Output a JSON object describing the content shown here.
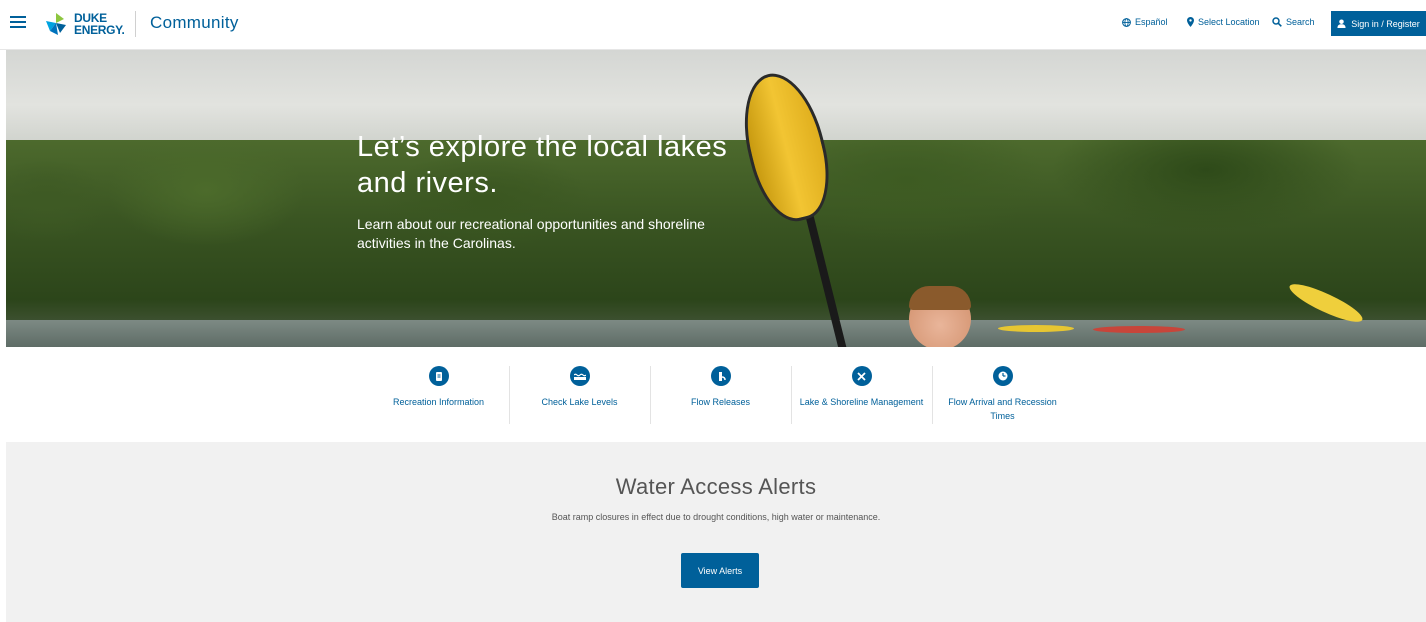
{
  "header": {
    "logo_line1": "DUKE",
    "logo_line2": "ENERGY.",
    "section_title": "Community",
    "utils": {
      "espanol": "Español",
      "location": "Select Location",
      "search": "Search"
    },
    "signin_label": "Sign in / Register"
  },
  "hero": {
    "title": "Let’s explore the local lakes and rivers.",
    "subtitle": "Learn about our recreational opportunities and shoreline activities in the Carolinas."
  },
  "quick_links": [
    {
      "label": "Recreation Information",
      "icon": "document-icon"
    },
    {
      "label": "Check Lake Levels",
      "icon": "water-level-icon"
    },
    {
      "label": "Flow Releases",
      "icon": "flow-icon"
    },
    {
      "label": "Lake & Shoreline Management",
      "icon": "tools-icon"
    },
    {
      "label": "Flow Arrival and Recession Times",
      "icon": "clock-icon"
    }
  ],
  "alerts": {
    "title": "Water Access Alerts",
    "text": "Boat ramp closures in effect due to drought conditions, high water or maintenance.",
    "button": "View Alerts"
  },
  "colors": {
    "brand_blue": "#00609a",
    "alert_bg": "#f1f1f1"
  }
}
